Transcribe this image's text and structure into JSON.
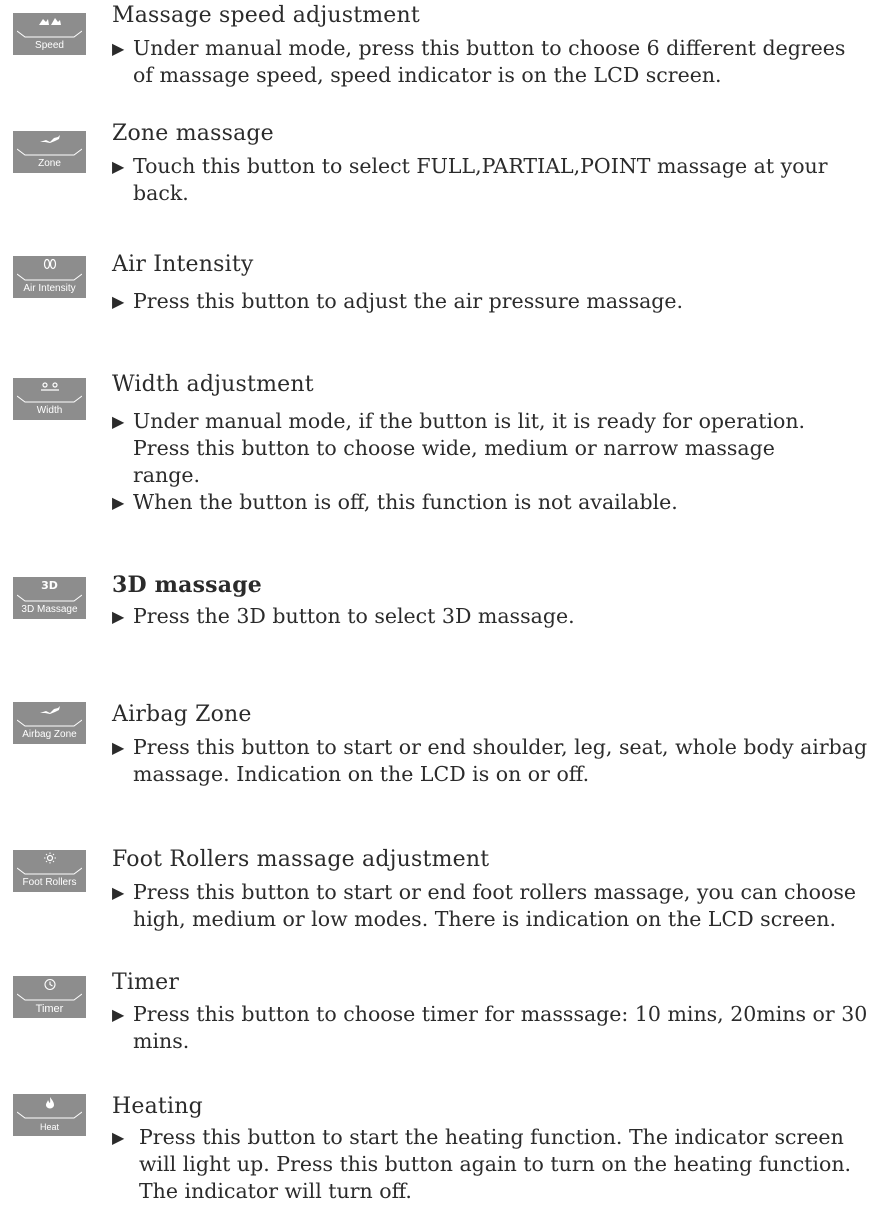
{
  "entries": [
    {
      "button_label": "Speed",
      "icon": "speed-icon",
      "title": "Massage speed adjustment",
      "bullets": [
        "Under manual mode, press this button to choose 6 different degrees of massage speed, speed indicator is on the LCD screen."
      ]
    },
    {
      "button_label": "Zone",
      "icon": "zone-icon",
      "title": "Zone massage",
      "bullets": [
        "Touch this button to select FULL,PARTIAL,POINT massage at your back."
      ]
    },
    {
      "button_label": "Air Intensity",
      "icon": "air-intensity-icon",
      "title": "Air Intensity",
      "bullets": [
        "Press this button to adjust the air pressure massage."
      ]
    },
    {
      "button_label": "Width",
      "icon": "width-icon",
      "title": "Width adjustment",
      "bullets": [
        "Under manual mode, if the button is lit, it is ready for operation. Press this button to choose wide, medium or narrow massage range.",
        "When the button is off, this function is not available."
      ]
    },
    {
      "button_label": "3D Massage",
      "icon": "3d-icon",
      "icon_text": "3D",
      "title": "3D massage",
      "bullets": [
        "Press the 3D button to select 3D massage."
      ]
    },
    {
      "button_label": "Airbag Zone",
      "icon": "airbag-zone-icon",
      "title": "Airbag Zone",
      "bullets": [
        "Press this button to start or end shoulder, leg, seat, whole body airbag massage. Indication on the LCD is on or off."
      ]
    },
    {
      "button_label": "Foot Rollers",
      "icon": "foot-rollers-icon",
      "title": "Foot Rollers massage adjustment",
      "bullets": [
        "Press this button to start or end foot rollers massage, you can choose high, medium or low modes. There is indication on the LCD screen."
      ]
    },
    {
      "button_label": "Timer",
      "icon": "timer-icon",
      "title": "Timer",
      "bullets": [
        "Press this button to choose timer for masssage: 10 mins, 20mins or 30 mins."
      ]
    },
    {
      "button_label": "Heat",
      "icon": "heat-icon",
      "title": "Heating",
      "bullets": [
        "Press this button to start the heating function.  The indicator screen will light up. Press this button again to turn on the heating function.  The indicator will turn off."
      ]
    }
  ],
  "colors": {
    "button_bg": "#8d8d8d",
    "button_text": "#ffffff",
    "text": "#2b2b2b"
  }
}
